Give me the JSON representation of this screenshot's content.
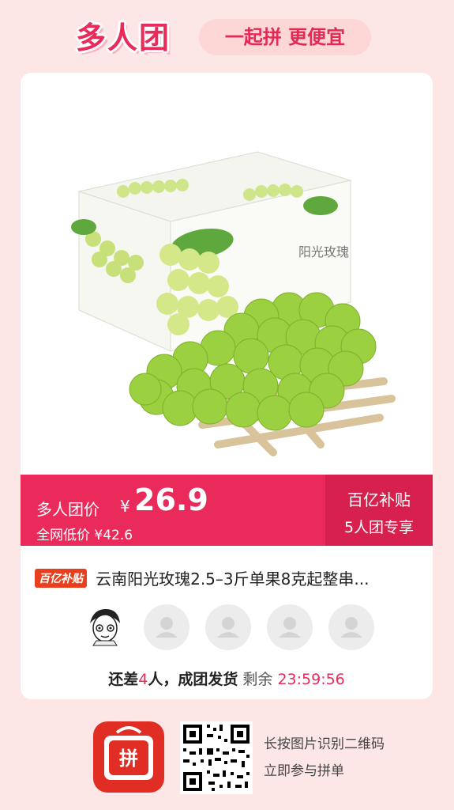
{
  "header": {
    "logo_text": "多人团",
    "slogan": "一起拼 更便宜"
  },
  "product": {
    "box_brand": "阳光玫瑰"
  },
  "price": {
    "group_label": "多人团价",
    "currency": "¥",
    "group_price": "26.9",
    "original_label": "全网低价 ¥42.6",
    "subsidy_title": "百亿补贴",
    "subsidy_sub": "5人团专享"
  },
  "title": {
    "badge": "百亿补贴",
    "text": "云南阳光玫瑰2.5–3斤单果8克起整串..."
  },
  "avatars": {
    "filled": 1,
    "empty": 4
  },
  "status": {
    "prefix": "还差",
    "count": "4",
    "suffix": "人，成团发货",
    "remain_label": "剩余",
    "countdown": "23:59:56"
  },
  "footer": {
    "app_logo_text": "拼",
    "hint_line1": "长按图片识别二维码",
    "hint_line2": "立即参与拼单"
  },
  "colors": {
    "brand_red": "#ea2a5a",
    "deep_red": "#d7204d",
    "bg_pink": "#fde7e6"
  }
}
